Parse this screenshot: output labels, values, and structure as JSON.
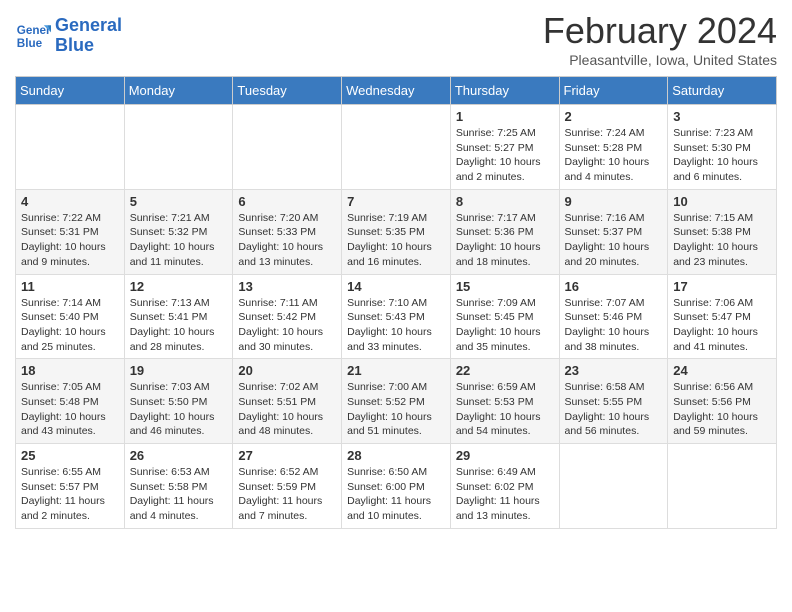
{
  "header": {
    "logo_line1": "General",
    "logo_line2": "Blue",
    "month_title": "February 2024",
    "location": "Pleasantville, Iowa, United States"
  },
  "weekdays": [
    "Sunday",
    "Monday",
    "Tuesday",
    "Wednesday",
    "Thursday",
    "Friday",
    "Saturday"
  ],
  "weeks": [
    [
      {
        "day": "",
        "info": ""
      },
      {
        "day": "",
        "info": ""
      },
      {
        "day": "",
        "info": ""
      },
      {
        "day": "",
        "info": ""
      },
      {
        "day": "1",
        "info": "Sunrise: 7:25 AM\nSunset: 5:27 PM\nDaylight: 10 hours\nand 2 minutes."
      },
      {
        "day": "2",
        "info": "Sunrise: 7:24 AM\nSunset: 5:28 PM\nDaylight: 10 hours\nand 4 minutes."
      },
      {
        "day": "3",
        "info": "Sunrise: 7:23 AM\nSunset: 5:30 PM\nDaylight: 10 hours\nand 6 minutes."
      }
    ],
    [
      {
        "day": "4",
        "info": "Sunrise: 7:22 AM\nSunset: 5:31 PM\nDaylight: 10 hours\nand 9 minutes."
      },
      {
        "day": "5",
        "info": "Sunrise: 7:21 AM\nSunset: 5:32 PM\nDaylight: 10 hours\nand 11 minutes."
      },
      {
        "day": "6",
        "info": "Sunrise: 7:20 AM\nSunset: 5:33 PM\nDaylight: 10 hours\nand 13 minutes."
      },
      {
        "day": "7",
        "info": "Sunrise: 7:19 AM\nSunset: 5:35 PM\nDaylight: 10 hours\nand 16 minutes."
      },
      {
        "day": "8",
        "info": "Sunrise: 7:17 AM\nSunset: 5:36 PM\nDaylight: 10 hours\nand 18 minutes."
      },
      {
        "day": "9",
        "info": "Sunrise: 7:16 AM\nSunset: 5:37 PM\nDaylight: 10 hours\nand 20 minutes."
      },
      {
        "day": "10",
        "info": "Sunrise: 7:15 AM\nSunset: 5:38 PM\nDaylight: 10 hours\nand 23 minutes."
      }
    ],
    [
      {
        "day": "11",
        "info": "Sunrise: 7:14 AM\nSunset: 5:40 PM\nDaylight: 10 hours\nand 25 minutes."
      },
      {
        "day": "12",
        "info": "Sunrise: 7:13 AM\nSunset: 5:41 PM\nDaylight: 10 hours\nand 28 minutes."
      },
      {
        "day": "13",
        "info": "Sunrise: 7:11 AM\nSunset: 5:42 PM\nDaylight: 10 hours\nand 30 minutes."
      },
      {
        "day": "14",
        "info": "Sunrise: 7:10 AM\nSunset: 5:43 PM\nDaylight: 10 hours\nand 33 minutes."
      },
      {
        "day": "15",
        "info": "Sunrise: 7:09 AM\nSunset: 5:45 PM\nDaylight: 10 hours\nand 35 minutes."
      },
      {
        "day": "16",
        "info": "Sunrise: 7:07 AM\nSunset: 5:46 PM\nDaylight: 10 hours\nand 38 minutes."
      },
      {
        "day": "17",
        "info": "Sunrise: 7:06 AM\nSunset: 5:47 PM\nDaylight: 10 hours\nand 41 minutes."
      }
    ],
    [
      {
        "day": "18",
        "info": "Sunrise: 7:05 AM\nSunset: 5:48 PM\nDaylight: 10 hours\nand 43 minutes."
      },
      {
        "day": "19",
        "info": "Sunrise: 7:03 AM\nSunset: 5:50 PM\nDaylight: 10 hours\nand 46 minutes."
      },
      {
        "day": "20",
        "info": "Sunrise: 7:02 AM\nSunset: 5:51 PM\nDaylight: 10 hours\nand 48 minutes."
      },
      {
        "day": "21",
        "info": "Sunrise: 7:00 AM\nSunset: 5:52 PM\nDaylight: 10 hours\nand 51 minutes."
      },
      {
        "day": "22",
        "info": "Sunrise: 6:59 AM\nSunset: 5:53 PM\nDaylight: 10 hours\nand 54 minutes."
      },
      {
        "day": "23",
        "info": "Sunrise: 6:58 AM\nSunset: 5:55 PM\nDaylight: 10 hours\nand 56 minutes."
      },
      {
        "day": "24",
        "info": "Sunrise: 6:56 AM\nSunset: 5:56 PM\nDaylight: 10 hours\nand 59 minutes."
      }
    ],
    [
      {
        "day": "25",
        "info": "Sunrise: 6:55 AM\nSunset: 5:57 PM\nDaylight: 11 hours\nand 2 minutes."
      },
      {
        "day": "26",
        "info": "Sunrise: 6:53 AM\nSunset: 5:58 PM\nDaylight: 11 hours\nand 4 minutes."
      },
      {
        "day": "27",
        "info": "Sunrise: 6:52 AM\nSunset: 5:59 PM\nDaylight: 11 hours\nand 7 minutes."
      },
      {
        "day": "28",
        "info": "Sunrise: 6:50 AM\nSunset: 6:00 PM\nDaylight: 11 hours\nand 10 minutes."
      },
      {
        "day": "29",
        "info": "Sunrise: 6:49 AM\nSunset: 6:02 PM\nDaylight: 11 hours\nand 13 minutes."
      },
      {
        "day": "",
        "info": ""
      },
      {
        "day": "",
        "info": ""
      }
    ]
  ]
}
